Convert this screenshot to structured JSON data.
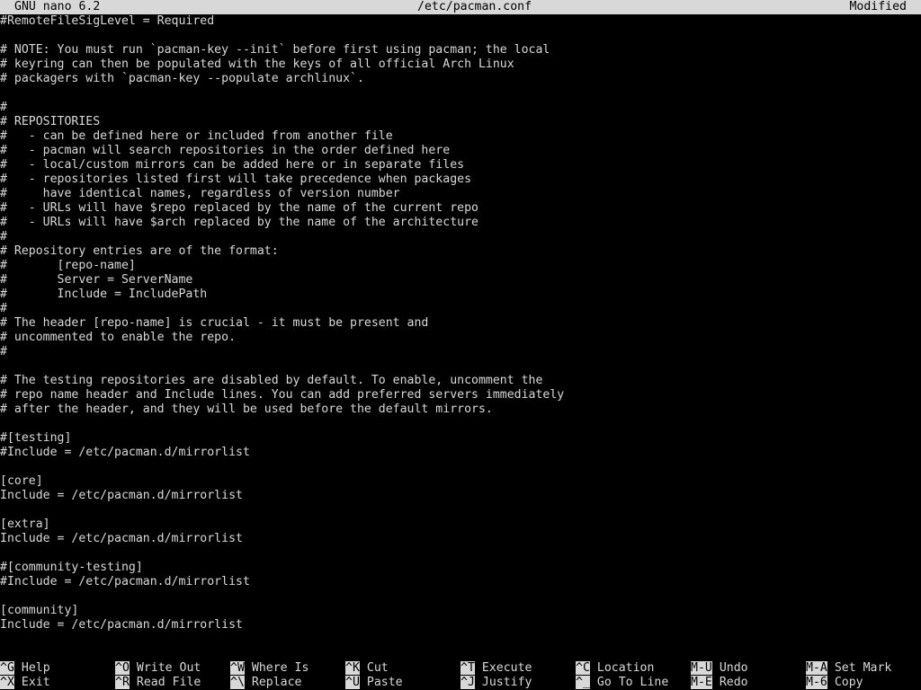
{
  "titlebar": {
    "app": "GNU nano 6.2",
    "file": "/etc/pacman.conf",
    "status": "Modified"
  },
  "editor": {
    "lines": [
      "#RemoteFileSigLevel = Required",
      "",
      "# NOTE: You must run `pacman-key --init` before first using pacman; the local",
      "# keyring can then be populated with the keys of all official Arch Linux",
      "# packagers with `pacman-key --populate archlinux`.",
      "",
      "#",
      "# REPOSITORIES",
      "#   - can be defined here or included from another file",
      "#   - pacman will search repositories in the order defined here",
      "#   - local/custom mirrors can be added here or in separate files",
      "#   - repositories listed first will take precedence when packages",
      "#     have identical names, regardless of version number",
      "#   - URLs will have $repo replaced by the name of the current repo",
      "#   - URLs will have $arch replaced by the name of the architecture",
      "#",
      "# Repository entries are of the format:",
      "#       [repo-name]",
      "#       Server = ServerName",
      "#       Include = IncludePath",
      "#",
      "# The header [repo-name] is crucial - it must be present and",
      "# uncommented to enable the repo.",
      "#",
      "",
      "# The testing repositories are disabled by default. To enable, uncomment the",
      "# repo name header and Include lines. You can add preferred servers immediately",
      "# after the header, and they will be used before the default mirrors.",
      "",
      "#[testing]",
      "#Include = /etc/pacman.d/mirrorlist",
      "",
      "[core]",
      "Include = /etc/pacman.d/mirrorlist",
      "",
      "[extra]",
      "Include = /etc/pacman.d/mirrorlist",
      "",
      "#[community-testing]",
      "#Include = /etc/pacman.d/mirrorlist",
      "",
      "[community]",
      "Include = /etc/pacman.d/mirrorlist",
      ""
    ]
  },
  "shortcuts": {
    "row1": [
      {
        "key": "^G",
        "label": "Help"
      },
      {
        "key": "^O",
        "label": "Write Out"
      },
      {
        "key": "^W",
        "label": "Where Is"
      },
      {
        "key": "^K",
        "label": "Cut"
      },
      {
        "key": "^T",
        "label": "Execute"
      },
      {
        "key": "^C",
        "label": "Location"
      },
      {
        "key": "M-U",
        "label": "Undo"
      },
      {
        "key": "M-A",
        "label": "Set Mark"
      }
    ],
    "row2": [
      {
        "key": "^X",
        "label": "Exit"
      },
      {
        "key": "^R",
        "label": "Read File"
      },
      {
        "key": "^\\",
        "label": "Replace"
      },
      {
        "key": "^U",
        "label": "Paste"
      },
      {
        "key": "^J",
        "label": "Justify"
      },
      {
        "key": "^_",
        "label": "Go To Line"
      },
      {
        "key": "M-E",
        "label": "Redo"
      },
      {
        "key": "M-6",
        "label": "Copy"
      }
    ]
  }
}
